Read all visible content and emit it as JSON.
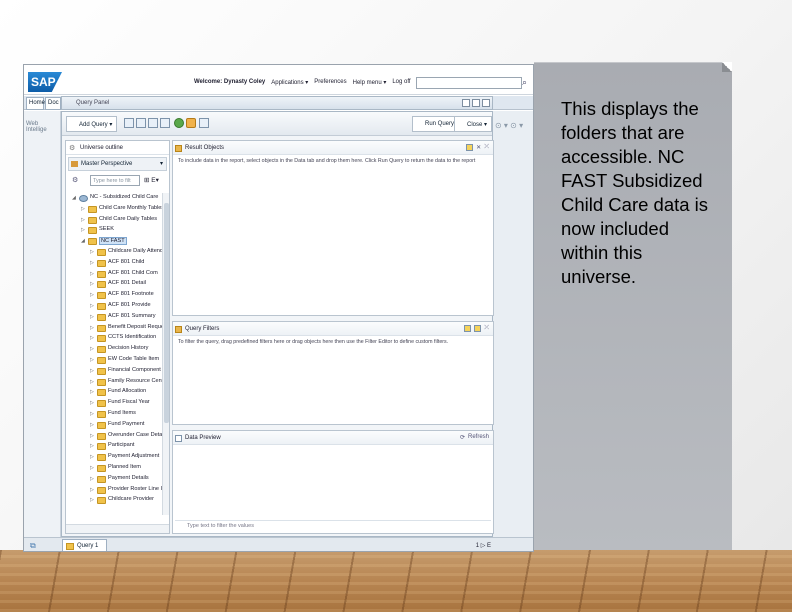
{
  "caption": "This displays the folders that are accessible. NC FAST Subsidized Child Care data is now included within this universe.",
  "sap_header": {
    "logo": "SAP",
    "welcome": "Welcome: Dynasty Coley",
    "links": [
      "Applications ▾",
      "Preferences",
      "Help menu ▾",
      "Log off"
    ]
  },
  "tabs": [
    "Home",
    "Doc"
  ],
  "query_panel": {
    "title": "Query Panel",
    "toolbar": {
      "add_query": "Add Query ▾",
      "run_query": "Run Query",
      "close": "Close ▾"
    },
    "outline": {
      "title": "Universe outline",
      "perspective": "Master Perspective",
      "search_placeholder": "Type here to filt",
      "tree": [
        {
          "label": "NC - Subsidized Child Care",
          "level": 0,
          "open": true
        },
        {
          "label": "Child Care Monthly Tables",
          "level": 1
        },
        {
          "label": "Child Care Daily Tables",
          "level": 1
        },
        {
          "label": "SEEK",
          "level": 1
        },
        {
          "label": "NC FAST",
          "level": 1,
          "open": true,
          "selected": true
        },
        {
          "label": "Childcare Daily Attendan",
          "level": 2
        },
        {
          "label": "ACF 801 Child",
          "level": 2
        },
        {
          "label": "ACF 801 Child Com",
          "level": 2
        },
        {
          "label": "ACF 801 Detail",
          "level": 2
        },
        {
          "label": "ACF 801 Footnote",
          "level": 2
        },
        {
          "label": "ACF 801 Provide",
          "level": 2
        },
        {
          "label": "ACF 801 Summary",
          "level": 2
        },
        {
          "label": "Benefit Deposit Reques",
          "level": 2
        },
        {
          "label": "CCTS Identification",
          "level": 2
        },
        {
          "label": "Decision History",
          "level": 2
        },
        {
          "label": "EW Code Table Item",
          "level": 2
        },
        {
          "label": "Financial Component",
          "level": 2
        },
        {
          "label": "Family Resource Center",
          "level": 2
        },
        {
          "label": "Fund Allocation",
          "level": 2
        },
        {
          "label": "Fund Fiscal Year",
          "level": 2
        },
        {
          "label": "Fund Items",
          "level": 2
        },
        {
          "label": "Fund Payment",
          "level": 2
        },
        {
          "label": "Overunder Case Detail",
          "level": 2
        },
        {
          "label": "Participant",
          "level": 2
        },
        {
          "label": "Payment Adjustment",
          "level": 2
        },
        {
          "label": "Planned Item",
          "level": 2
        },
        {
          "label": "Payment Details",
          "level": 2
        },
        {
          "label": "Provider Roster Line In",
          "level": 2
        },
        {
          "label": "Childcare Provider",
          "level": 2
        }
      ]
    },
    "result_objects": {
      "title": "Result Objects",
      "message": "To include data in the report, select objects in the Data tab and drop them here. Click Run Query to return the data to the report"
    },
    "query_filters": {
      "title": "Query Filters",
      "message": "To filter the query, drag predefined filters here or drag objects here then use the Filter Editor to define custom filters."
    },
    "data_preview": {
      "title": "Data Preview",
      "refresh": "Refresh",
      "filter_placeholder": "Type text to filter the values"
    }
  },
  "bottom": {
    "query_tab": "Query 1",
    "page_nav": "1 ▷ E"
  }
}
